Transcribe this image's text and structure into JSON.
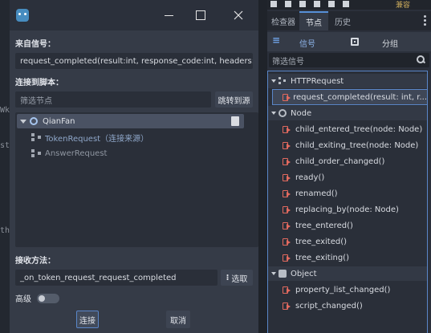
{
  "background": {
    "code_fragments": [
      "Wk",
      "st",
      "th"
    ]
  },
  "dialog": {
    "from_signal_label": "来自信号：",
    "signal_value": "request_completed(result:int, response_code:int, headers:Pac",
    "connect_to_script_label": "连接到脚本：",
    "filter_placeholder": "筛选节点",
    "goto_source_button": "跳转到源",
    "tree": [
      {
        "label": "QianFan",
        "style": "selected"
      },
      {
        "label": "TokenRequest（连接来源）",
        "style": "blueish"
      },
      {
        "label": "AnswerRequest",
        "style": "muted"
      }
    ],
    "receiver_method_label": "接收方法：",
    "method_value": "_on_token_request_request_completed",
    "pick_button": "选取",
    "advanced_label": "高级",
    "connect_button": "连接",
    "cancel_button": "取消"
  },
  "panel": {
    "top_text": "兼容",
    "tabs": [
      "检查器",
      "节点",
      "历史"
    ],
    "active_tab": "节点",
    "subtabs": [
      "信号",
      "分组"
    ],
    "filter_placeholder": "筛选信号",
    "groups": [
      {
        "name": "HTTPRequest",
        "icon": "net",
        "signals": [
          "request_completed(result: int, r..."
        ]
      },
      {
        "name": "Node",
        "icon": "ring",
        "signals": [
          "child_entered_tree(node: Node)",
          "child_exiting_tree(node: Node)",
          "child_order_changed()",
          "ready()",
          "renamed()",
          "replacing_by(node: Node)",
          "tree_entered()",
          "tree_exited()",
          "tree_exiting()"
        ]
      },
      {
        "name": "Object",
        "icon": "box",
        "signals": [
          "property_list_changed()",
          "script_changed()"
        ]
      }
    ]
  },
  "colors": {
    "accent": "#5790d8",
    "signal_icon": "#e36a5f",
    "dialog_bg": "#353b47"
  }
}
